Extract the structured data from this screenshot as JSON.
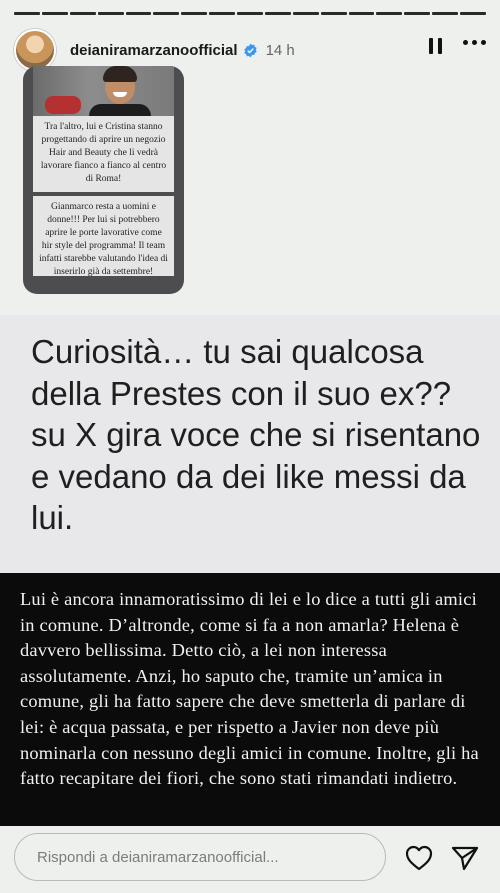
{
  "progress": {
    "total_segments": 17,
    "completed": 17
  },
  "header": {
    "username": "deianiramarzanoofficial",
    "timestamp": "14 h",
    "verified_icon": "verified-badge-icon",
    "pause_icon": "pause-icon",
    "more_icon": "more-options-icon"
  },
  "repost": {
    "text_1": "Tra l'altro, lui e Cristina stanno progettando di aprire un negozio Hair and Beauty che li vedrà lavorare fianco a fianco al centro di Roma!",
    "text_2": "Gianmarco resta a uomini e donne!!! Per lui si potrebbero aprire le porte lavorative come hir style del programma! Il team infatti starebbe valutando l'idea di inserirlo già da settembre!"
  },
  "question": {
    "text": "Curiosità… tu sai qualcosa della Prestes con il suo ex?? su X gira voce che si risentano e vedano da dei like messi da lui."
  },
  "answer": {
    "text": "Lui è ancora innamoratissimo di lei e lo dice a tutti gli amici in comune. D’altronde, come si fa a non amarla? Helena è davvero bellissima. Detto ciò, a lei non interessa assolutamente. Anzi, ho saputo che, tramite un’amica in comune, gli ha fatto sapere che deve smetterla di parlare di lei: è acqua passata, e per rispetto a Javier non deve più nominarla con nessuno degli amici in comune. Inoltre, gli ha fatto recapitare dei fiori, che sono stati rimandati indietro."
  },
  "footer": {
    "reply_placeholder": "Rispondi a deianiramarzanoofficial...",
    "like_icon": "heart-icon",
    "send_icon": "send-icon"
  },
  "colors": {
    "background": "#eef0ee",
    "answer_background": "#0b0b0b",
    "answer_text": "#f1f1f1",
    "verified_blue": "#3897f0"
  }
}
